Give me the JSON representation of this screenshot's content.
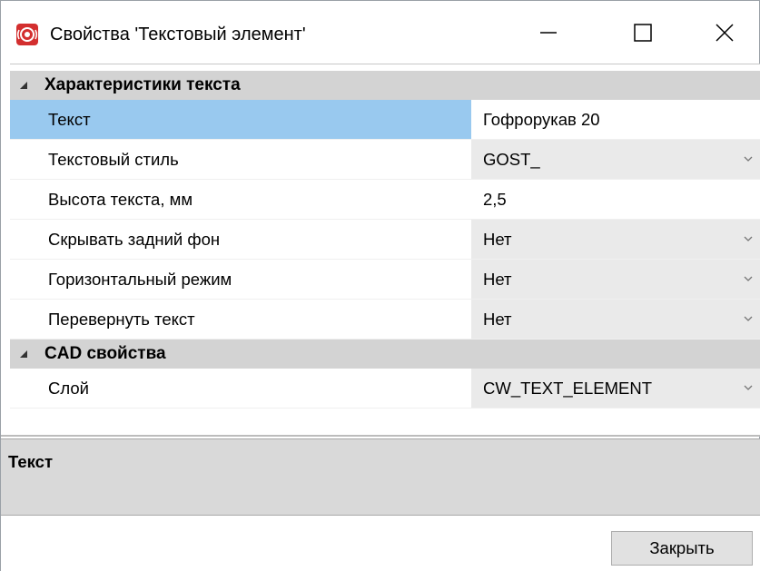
{
  "window": {
    "title": "Свойства 'Текстовый элемент'",
    "app_icon": "app-logo-icon",
    "controls": {
      "minimize": "minimize-icon",
      "maximize": "maximize-icon",
      "close": "close-icon"
    }
  },
  "grid": {
    "categories": [
      {
        "label": "Характеристики текста",
        "rows": [
          {
            "name": "Текст",
            "value": "Гофрорукав 20",
            "dropdown": false,
            "selected": true
          },
          {
            "name": "Текстовый стиль",
            "value": "GOST_",
            "dropdown": true
          },
          {
            "name": "Высота текста, мм",
            "value": "2,5",
            "dropdown": false
          },
          {
            "name": "Скрывать задний фон",
            "value": "Нет",
            "dropdown": true
          },
          {
            "name": "Горизонтальный режим",
            "value": "Нет",
            "dropdown": true
          },
          {
            "name": "Перевернуть текст",
            "value": "Нет",
            "dropdown": true
          }
        ]
      },
      {
        "label": "CAD свойства",
        "rows": [
          {
            "name": "Слой",
            "value": "CW_TEXT_ELEMENT",
            "dropdown": true
          }
        ]
      }
    ]
  },
  "description": {
    "title": "Текст"
  },
  "footer": {
    "close_label": "Закрыть"
  },
  "colors": {
    "selected_row": "#99c9ef",
    "category_bg": "#d3d3d3",
    "dropdown_bg": "#eaeaea",
    "description_bg": "#d9d9d9",
    "app_icon_red": "#d32f2f"
  }
}
